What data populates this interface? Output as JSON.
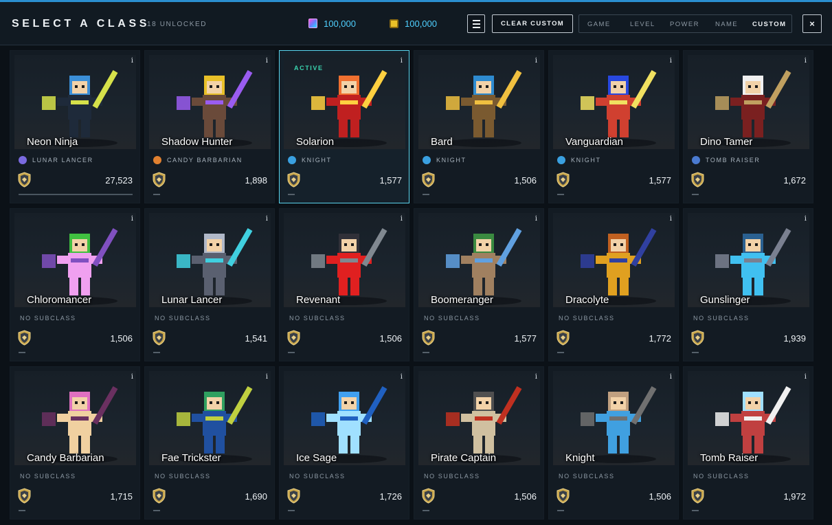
{
  "header": {
    "title": "SELECT A CLASS",
    "unlocked": "18 UNLOCKED",
    "gems": "100,000",
    "coins": "100,000",
    "clear_custom": "CLEAR CUSTOM",
    "sort_options": [
      "GAME",
      "LEVEL",
      "POWER",
      "NAME",
      "CUSTOM"
    ],
    "active_sort": "CUSTOM",
    "close": "×"
  },
  "active_label": "ACTIVE",
  "info_label": "i",
  "classes": [
    {
      "name": "Neon Ninja",
      "subclass": "LUNAR LANCER",
      "power": "27,523",
      "active": false
    },
    {
      "name": "Shadow Hunter",
      "subclass": "CANDY BARBARIAN",
      "power": "1,898",
      "active": false
    },
    {
      "name": "Solarion",
      "subclass": "KNIGHT",
      "power": "1,577",
      "active": true
    },
    {
      "name": "Bard",
      "subclass": "KNIGHT",
      "power": "1,506",
      "active": false
    },
    {
      "name": "Vanguardian",
      "subclass": "KNIGHT",
      "power": "1,577",
      "active": false
    },
    {
      "name": "Dino Tamer",
      "subclass": "TOMB RAISER",
      "power": "1,672",
      "active": false
    },
    {
      "name": "Chloromancer",
      "subclass": "NO SUBCLASS",
      "power": "1,506",
      "active": false
    },
    {
      "name": "Lunar Lancer",
      "subclass": "NO SUBCLASS",
      "power": "1,541",
      "active": false
    },
    {
      "name": "Revenant",
      "subclass": "NO SUBCLASS",
      "power": "1,506",
      "active": false
    },
    {
      "name": "Boomeranger",
      "subclass": "NO SUBCLASS",
      "power": "1,577",
      "active": false
    },
    {
      "name": "Dracolyte",
      "subclass": "NO SUBCLASS",
      "power": "1,772",
      "active": false
    },
    {
      "name": "Gunslinger",
      "subclass": "NO SUBCLASS",
      "power": "1,939",
      "active": false
    },
    {
      "name": "Candy Barbarian",
      "subclass": "NO SUBCLASS",
      "power": "1,715",
      "active": false
    },
    {
      "name": "Fae Trickster",
      "subclass": "NO SUBCLASS",
      "power": "1,690",
      "active": false
    },
    {
      "name": "Ice Sage",
      "subclass": "NO SUBCLASS",
      "power": "1,726",
      "active": false
    },
    {
      "name": "Pirate Captain",
      "subclass": "NO SUBCLASS",
      "power": "1,506",
      "active": false
    },
    {
      "name": "Knight",
      "subclass": "NO SUBCLASS",
      "power": "1,506",
      "active": false
    },
    {
      "name": "Tomb Raiser",
      "subclass": "NO SUBCLASS",
      "power": "1,972",
      "active": false
    }
  ],
  "colors": {
    "accent": "#4fd0ff",
    "active_border": "#5ad5ee",
    "active_text": "#3ad6b0"
  }
}
